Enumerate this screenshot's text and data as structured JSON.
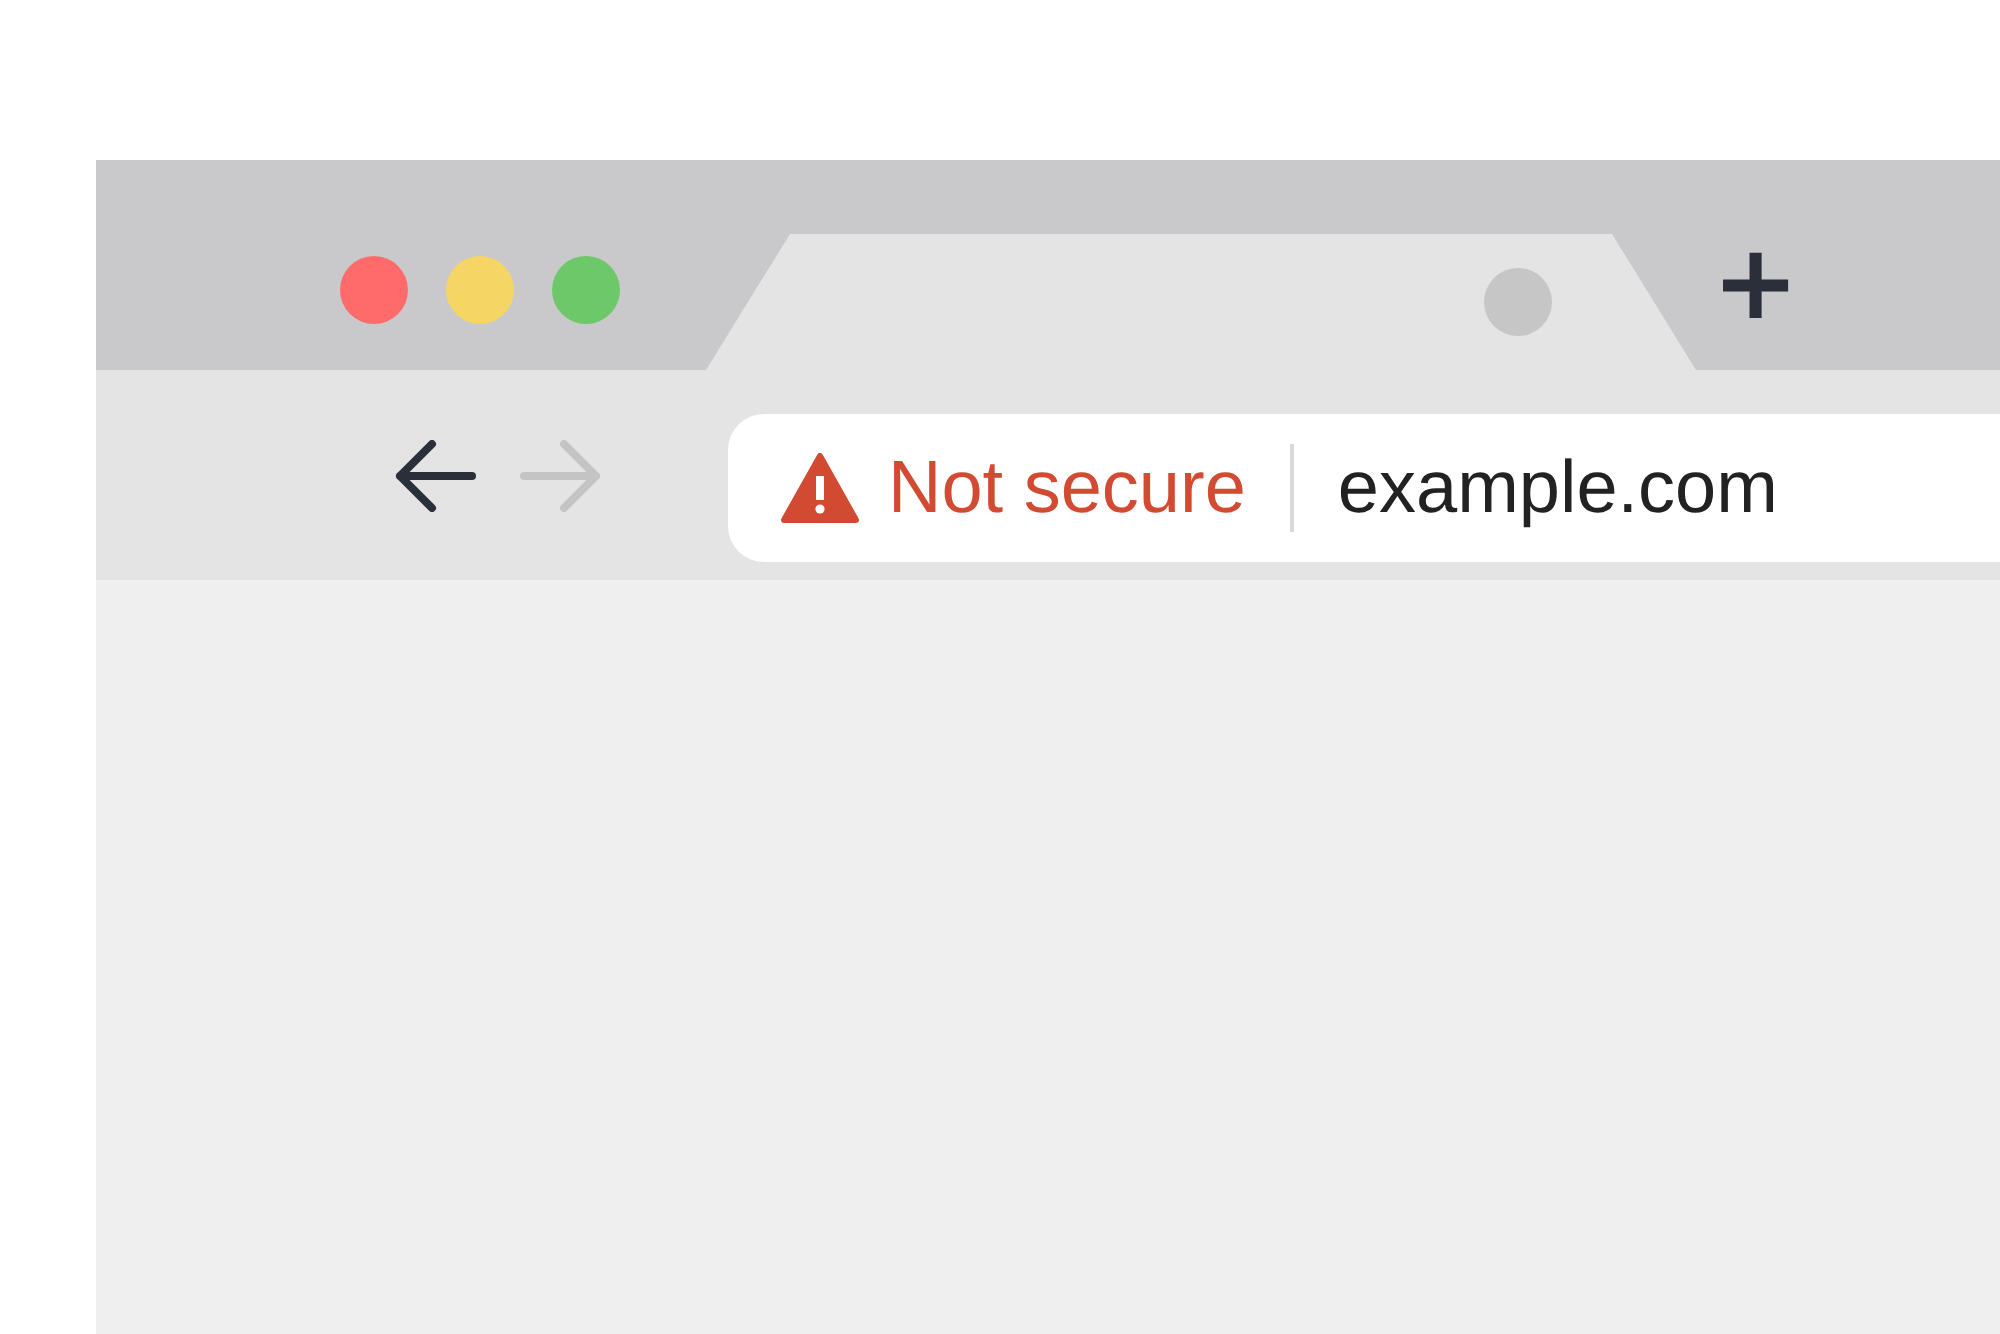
{
  "window_controls": [
    {
      "color": "#ff6b6b"
    },
    {
      "color": "#f5d563"
    },
    {
      "color": "#6cc868"
    }
  ],
  "new_tab": "+",
  "nav": {
    "back": {
      "disabled": false
    },
    "forward": {
      "disabled": true
    }
  },
  "address_bar": {
    "security_label": "Not secure",
    "url": "example.com"
  }
}
